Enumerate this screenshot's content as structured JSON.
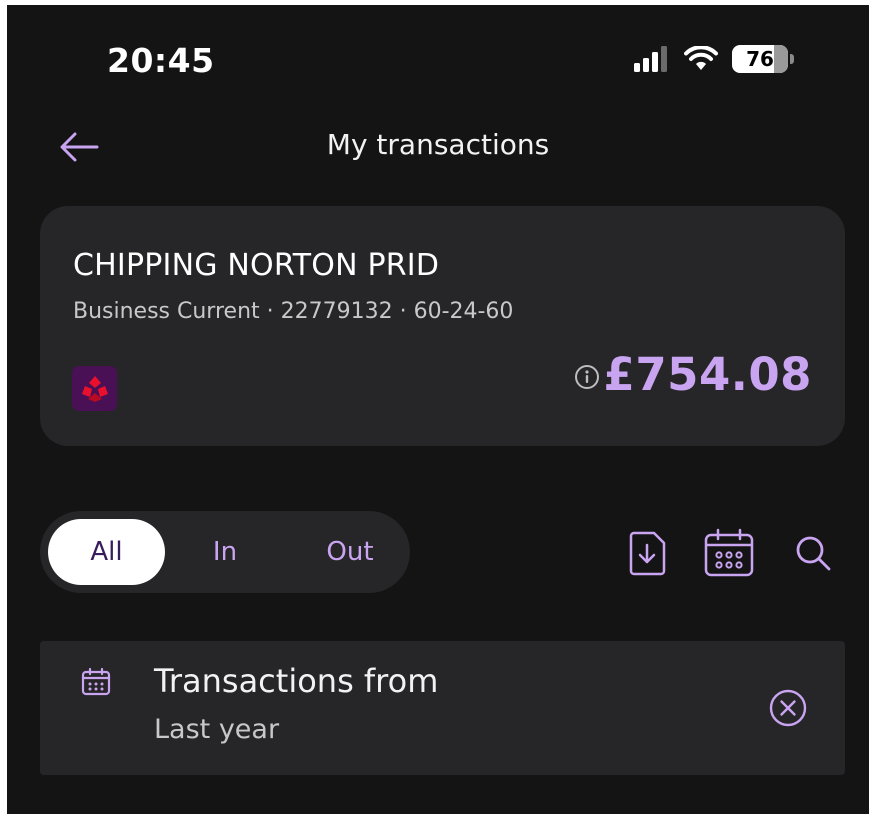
{
  "status_bar": {
    "time": "20:45",
    "battery_level": "76",
    "icons": [
      "signal-icon",
      "wifi-icon",
      "battery-icon"
    ]
  },
  "header": {
    "title": "My transactions",
    "back_icon": "arrow-left-icon"
  },
  "account": {
    "name": "CHIPPING NORTON PRID",
    "details": "Business Current · 22779132 · 60-24-60",
    "balance": "£754.08",
    "logo_icon": "bank-logo-icon",
    "info_icon": "info-icon"
  },
  "filters": {
    "options": [
      {
        "label": "All",
        "selected": true
      },
      {
        "label": "In",
        "selected": false
      },
      {
        "label": "Out",
        "selected": false
      }
    ],
    "tools": [
      "export-statement-icon",
      "calendar-icon",
      "search-icon"
    ]
  },
  "date_filter": {
    "title": "Transactions from",
    "value": "Last year",
    "clear_icon": "close-circle-icon"
  },
  "colors": {
    "background": "#141414",
    "card": "#262528",
    "accent": "#c9a4f0",
    "text": "#ffffff",
    "muted_text": "#c8c8c8",
    "bank_logo_bg": "#4a1055",
    "bank_logo_red": "#e8102d"
  }
}
